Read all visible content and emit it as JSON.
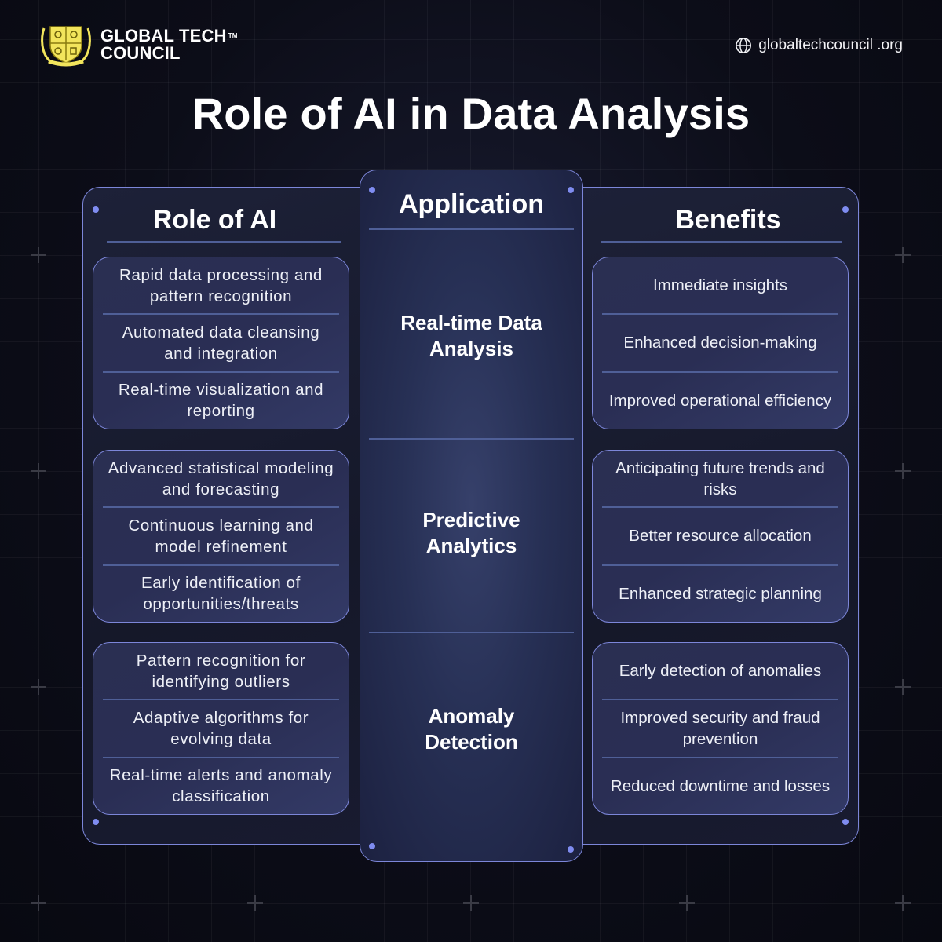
{
  "brand": {
    "name_line1": "GLOBAL TECH",
    "name_line2": "COUNCIL",
    "trademark": "TM",
    "crest_icon": "crest-shield-icon",
    "website_icon": "globe-icon",
    "website": "globaltechcouncil .org"
  },
  "title": "Role of AI in Data Analysis",
  "colors": {
    "background": "#0c0d18",
    "panel_border": "#7c86d9",
    "accent_dot": "#7f8cf0",
    "divider": "#4f5f97",
    "crest_yellow": "#f2e55c"
  },
  "columns": {
    "role": {
      "heading": "Role of AI"
    },
    "application": {
      "heading": "Application"
    },
    "benefits": {
      "heading": "Benefits"
    }
  },
  "rows": [
    {
      "application": "Real-time Data Analysis",
      "roles": [
        "Rapid data processing and pattern recognition",
        "Automated data cleansing and integration",
        "Real-time visualization and reporting"
      ],
      "benefits": [
        "Immediate insights",
        "Enhanced decision-making",
        "Improved operational efficiency"
      ]
    },
    {
      "application": "Predictive Analytics",
      "roles": [
        "Advanced statistical modeling and forecasting",
        "Continuous learning and model refinement",
        "Early identification of opportunities/threats"
      ],
      "benefits": [
        "Anticipating future trends and risks",
        "Better resource allocation",
        "Enhanced strategic planning"
      ]
    },
    {
      "application": "Anomaly Detection",
      "roles": [
        "Pattern recognition for identifying outliers",
        "Adaptive algorithms for evolving data",
        "Real-time alerts and anomaly classification"
      ],
      "benefits": [
        "Early detection of anomalies",
        "Improved security and fraud prevention",
        "Reduced downtime and losses"
      ]
    }
  ]
}
